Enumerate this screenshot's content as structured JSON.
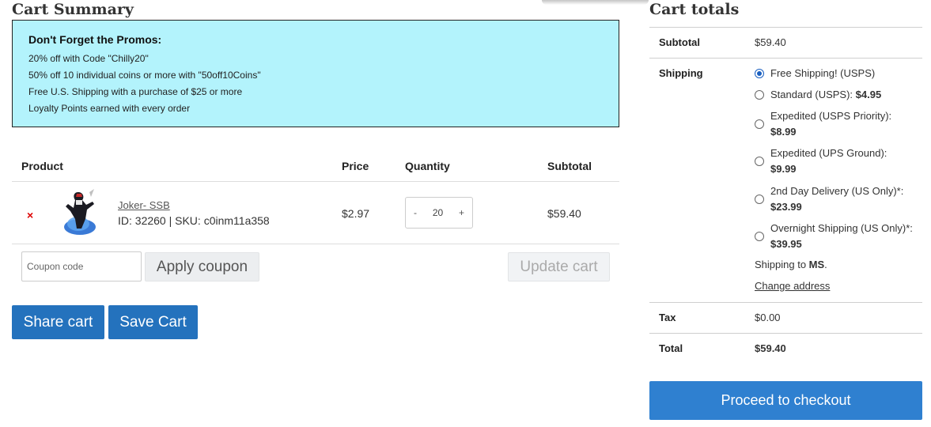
{
  "cart_summary": {
    "title": "Cart Summary",
    "promo": {
      "title": "Don't Forget the Promos:",
      "lines": [
        "20% off with Code \"Chilly20\"",
        "50% off 10 individual coins or more with \"50off10Coins\"",
        "Free U.S. Shipping with a purchase of $25 or more",
        "Loyalty Points earned with every order"
      ]
    },
    "headers": {
      "product": "Product",
      "price": "Price",
      "quantity": "Quantity",
      "subtotal": "Subtotal"
    },
    "item": {
      "remove": "×",
      "name": "Joker- SSB",
      "meta": "ID: 32260 | SKU: c0inm11a358",
      "price": "$2.97",
      "qty_minus": "-",
      "qty": "20",
      "qty_plus": "+",
      "subtotal": "$59.40"
    },
    "coupon_placeholder": "Coupon code",
    "apply_coupon": "Apply coupon",
    "update_cart": "Update cart",
    "share_cart": "Share cart",
    "save_cart": "Save Cart"
  },
  "cart_totals": {
    "title": "Cart totals",
    "subtotal_label": "Subtotal",
    "subtotal_value": "$59.40",
    "shipping_label": "Shipping",
    "shipping_options": [
      {
        "label": "Free Shipping! (USPS)",
        "price": "",
        "checked": true
      },
      {
        "label": "Standard (USPS): ",
        "price": "$4.95",
        "checked": false
      },
      {
        "label": "Expedited (USPS Priority):",
        "price": "$8.99",
        "checked": false
      },
      {
        "label": "Expedited (UPS Ground):",
        "price": "$9.99",
        "checked": false
      },
      {
        "label": "2nd Day Delivery (US Only)*:",
        "price": "$23.99",
        "checked": false
      },
      {
        "label": "Overnight Shipping (US Only)*:",
        "price": "$39.95",
        "checked": false
      }
    ],
    "shipping_to_prefix": "Shipping to ",
    "shipping_to_state": "MS",
    "shipping_to_suffix": ".",
    "change_address": "Change address",
    "tax_label": "Tax",
    "tax_value": "$0.00",
    "total_label": "Total",
    "total_value": "$59.40",
    "checkout": "Proceed to checkout"
  },
  "colors": {
    "promo_bg": "#b3f3fc",
    "primary": "#2472bd",
    "checkout": "#2f80d0",
    "remove": "#dd0000"
  }
}
